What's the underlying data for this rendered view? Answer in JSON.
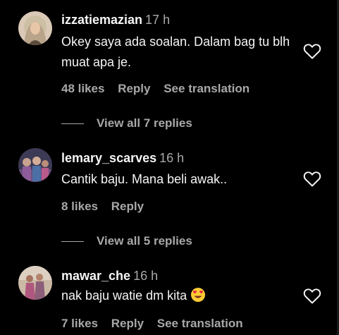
{
  "comments": [
    {
      "username": "izzatiemazian",
      "time": "17 h",
      "text": "Okey saya ada soalan. Dalam bag tu blh muat apa je.",
      "likes": "48 likes",
      "reply": "Reply",
      "see_translation": "See translation",
      "view_replies": "View all 7 replies"
    },
    {
      "username": "lemary_scarves",
      "time": "16 h",
      "text": "Cantik baju. Mana beli awak..",
      "likes": "8 likes",
      "reply": "Reply",
      "view_replies": "View all 5 replies"
    },
    {
      "username": "mawar_che",
      "time": "16 h",
      "text": "nak baju watie dm kita",
      "emoji": "heart-eyes-emoji",
      "likes": "7 likes",
      "reply": "Reply",
      "see_translation": "See translation"
    }
  ],
  "icons": {
    "like": "heart-outline-icon"
  },
  "colors": {
    "background": "#000000",
    "primary_text": "#f5f5f5",
    "secondary_text": "#a8a8a8"
  }
}
